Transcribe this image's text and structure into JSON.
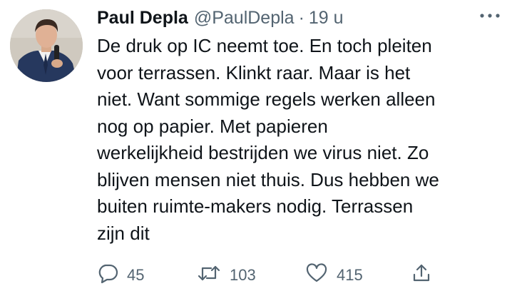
{
  "author": {
    "name": "Paul Depla",
    "handle": "@PaulDepla",
    "separator": "·",
    "time": "19 u"
  },
  "tweet": {
    "text": "De druk op IC neemt toe. En toch pleiten\nvoor terrassen. Klinkt raar. Maar is het\nniet. Want sommige regels werken alleen\nnog op papier. Met papieren\nwerkelijkheid bestrijden we virus niet. Zo\nblijven mensen niet thuis. Dus hebben we\nbuiten ruimte-makers nodig. Terrassen\nzijn dit"
  },
  "actions": {
    "reply": {
      "icon": "reply-icon",
      "count": "45"
    },
    "retweet": {
      "icon": "retweet-icon",
      "count": "103"
    },
    "like": {
      "icon": "heart-icon",
      "count": "415"
    },
    "share": {
      "icon": "share-icon"
    }
  },
  "icons": {
    "more": "more-options-icon"
  },
  "colors": {
    "text": "#0f1419",
    "secondary": "#536471",
    "background": "#ffffff"
  }
}
